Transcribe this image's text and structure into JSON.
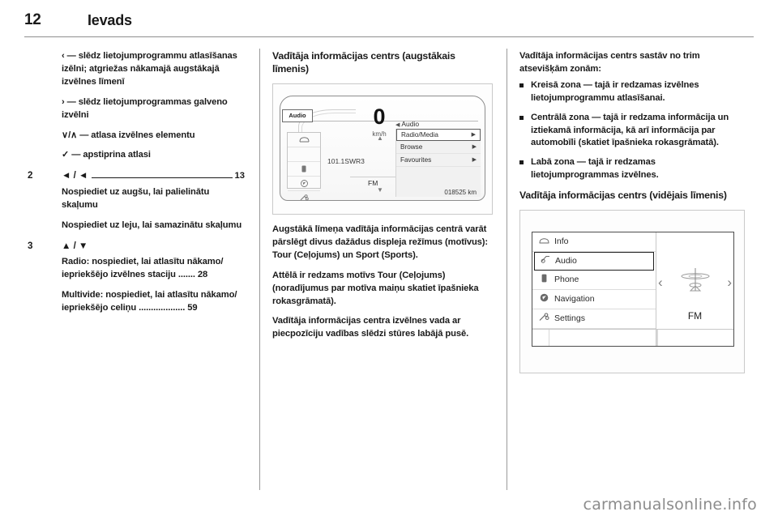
{
  "header": {
    "page_number": "12",
    "title": "Ievads"
  },
  "column1": {
    "controls": [
      {
        "icon": "‹",
        "dash": "—",
        "text": "‹ — slēdz lietojumprogrammu atlasīšanas izēlni; atgriežas nākamajā augstākajā izvēlnes līmenī"
      },
      {
        "icon": "›",
        "dash": "—",
        "text": "› — slēdz lietojumprogrammas galveno izvēlni"
      },
      {
        "icon": "∨/∧",
        "dash": "—",
        "text": "∨/∧ — atlasa izvēlnes elementu"
      },
      {
        "icon": "✓",
        "dash": "—",
        "text": "✓ — apstiprina atlasi"
      }
    ],
    "items": [
      {
        "number": "2",
        "icon": "◄ / ◄",
        "page": "13",
        "descriptions": [
          "Nospiediet uz augšu, lai palielinātu skaļumu",
          "Nospiediet uz leju, lai samazinātu skaļumu"
        ]
      },
      {
        "number": "3",
        "icon": "▲ / ▼",
        "page": "",
        "descriptions": [
          "Radio: nospiediet, lai atlasītu nākamo/ iepriekšējo izvēlnes staciju ....... 28",
          "Multivide: nospiediet, lai atlasītu nākamo/ iepriekšējo celiņu ................... 59"
        ]
      }
    ]
  },
  "column2": {
    "heading": "Vadītāja informācijas centrs (augstākais līmenis)",
    "figure": {
      "name": "driver-information-centre-uplevel",
      "speed": "0",
      "speed_unit": "km/h",
      "station": "101.1SWR3",
      "band": "FM",
      "odometer": "018525 km",
      "rail_selected": "Audio",
      "rail_icons": [
        "car-icon",
        "phone-icon",
        "navigation-icon",
        "settings-icon"
      ],
      "menu_label": "Audio",
      "menu_items": [
        {
          "label": "Radio/Media",
          "selected": true
        },
        {
          "label": "Browse",
          "selected": false
        },
        {
          "label": "Favourites",
          "selected": false
        }
      ]
    },
    "paragraphs": [
      "Augstākā līmeņa vadītāja informācijas centrā varāt pārslēgt divus dažādus displeja režīmus (motīvus): Tour (Ceļojums) un Sport (Sports).",
      "Attēlā ir redzams motīvs Tour (Ceļojums) (noradījumus par motīva maiņu skatiet īpašnieka rokasgrāmatā).",
      "Vadītāja informācijas centra izvēlnes vada ar piecpozīciju vadības slēdzi stūres labājā pusē."
    ]
  },
  "column3": {
    "intro": "Vadītāja informācijas centrs sastāv no trim atsevišķām zonām:",
    "bullets": [
      "Kreisā zona — tajā ir redzamas izvēlnes lietojumprogrammu atlasīšanai.",
      "Centrālā zona — tajā ir redzama informācija un iztiekamā informācija, kā arī informācija par automobīli (skatiet īpašnieka rokasgrāmatā).",
      "Labā zona — tajā ir redzamas lietojumprogrammas izvēlnes."
    ],
    "heading2": "Vadītāja informācijas centrs (vidējais līmenis)",
    "figure": {
      "name": "driver-information-centre-midlevel",
      "items": [
        {
          "label": "Info",
          "icon": "car-icon",
          "selected": false
        },
        {
          "label": "Audio",
          "icon": "audio-icon",
          "selected": true
        },
        {
          "label": "Phone",
          "icon": "phone-icon",
          "selected": false
        },
        {
          "label": "Navigation",
          "icon": "navigation-icon",
          "selected": false
        },
        {
          "label": "Settings",
          "icon": "settings-icon",
          "selected": false
        }
      ],
      "band": "FM",
      "left_arrow": "‹",
      "right_arrow": "›"
    }
  },
  "watermark": "carmanualsonline.info"
}
